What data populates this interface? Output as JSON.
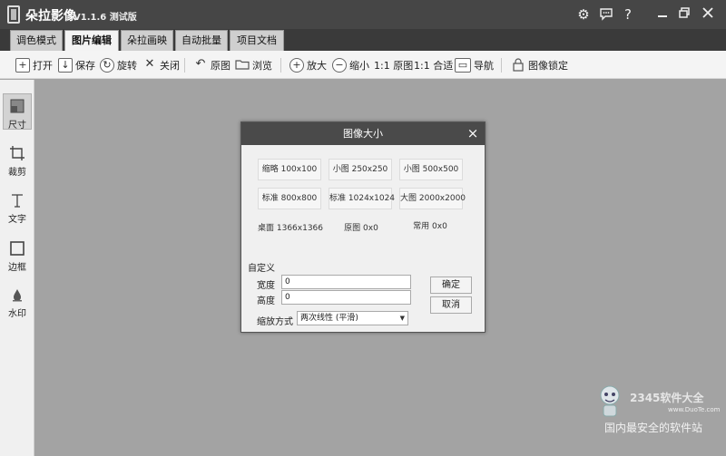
{
  "app": {
    "name": "朵拉影像",
    "version": "V1.1.6 测试版",
    "titlebar_icons": [
      "settings-icon",
      "feedback-icon",
      "help-icon",
      "minimize-icon",
      "restore-icon",
      "close-icon"
    ],
    "help_glyph": "?"
  },
  "tabs": [
    {
      "label": "调色模式",
      "active": false
    },
    {
      "label": "图片编辑",
      "active": true
    },
    {
      "label": "朵拉画映",
      "active": false
    },
    {
      "label": "自动批量",
      "active": false
    },
    {
      "label": "项目文档",
      "active": false
    }
  ],
  "toolbar": {
    "open": "打开",
    "save": "保存",
    "rotate": "旋转",
    "close": "关闭",
    "original": "原图",
    "browse": "浏览",
    "zoom_in": "放大",
    "zoom_out": "缩小",
    "one_to_one_original": "1:1 原图",
    "one_to_one_fit": "1:1 合适",
    "navigate": "导航",
    "lock_image": "图像锁定"
  },
  "sidebar": [
    {
      "label": "尺寸",
      "icon": "resize-icon",
      "active": true
    },
    {
      "label": "裁剪",
      "icon": "crop-icon",
      "active": false
    },
    {
      "label": "文字",
      "icon": "text-icon",
      "active": false
    },
    {
      "label": "边框",
      "icon": "border-icon",
      "active": false
    },
    {
      "label": "水印",
      "icon": "watermark-icon",
      "active": false
    }
  ],
  "dialog": {
    "title": "图像大小",
    "presets": [
      {
        "name": "缩略",
        "size": "100x100"
      },
      {
        "name": "小图",
        "size": "250x250"
      },
      {
        "name": "小图",
        "size": "500x500"
      },
      {
        "name": "标准",
        "size": "800x800"
      },
      {
        "name": "标准",
        "size": "1024x1024"
      },
      {
        "name": "大图",
        "size": "2000x2000"
      },
      {
        "name": "桌面",
        "size": "1366x1366"
      },
      {
        "name": "原图",
        "size": "0x0"
      },
      {
        "name": "常用",
        "size": "0x0"
      }
    ],
    "custom_label": "自定义",
    "width_label": "宽度",
    "width_value": "0",
    "height_label": "高度",
    "height_value": "0",
    "scale_mode_label": "缩放方式",
    "scale_mode_value": "两次线性 (平滑)",
    "ok_label": "确定",
    "cancel_label": "取消"
  },
  "watermark": {
    "center_text": "www.DuoTe.com",
    "brand": "2345软件大全",
    "url": "www.DuoTe.com",
    "slogan": "国内最安全的软件站"
  }
}
